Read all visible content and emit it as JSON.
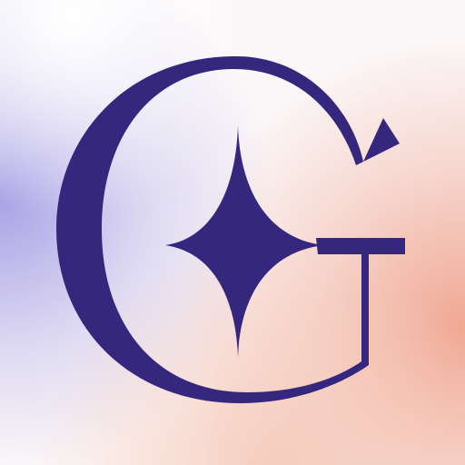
{
  "app_icon": {
    "glyph_color": "#35277d",
    "background": {
      "base": "#fbf7f8",
      "glow_color": "#ffffff",
      "accent_left": "#a9a3e6",
      "accent_right": "#f0a792",
      "accent_bottom": "#f6c9b8"
    },
    "icons": [
      "serif-g-letter-icon",
      "four-point-sparkle-icon"
    ]
  }
}
